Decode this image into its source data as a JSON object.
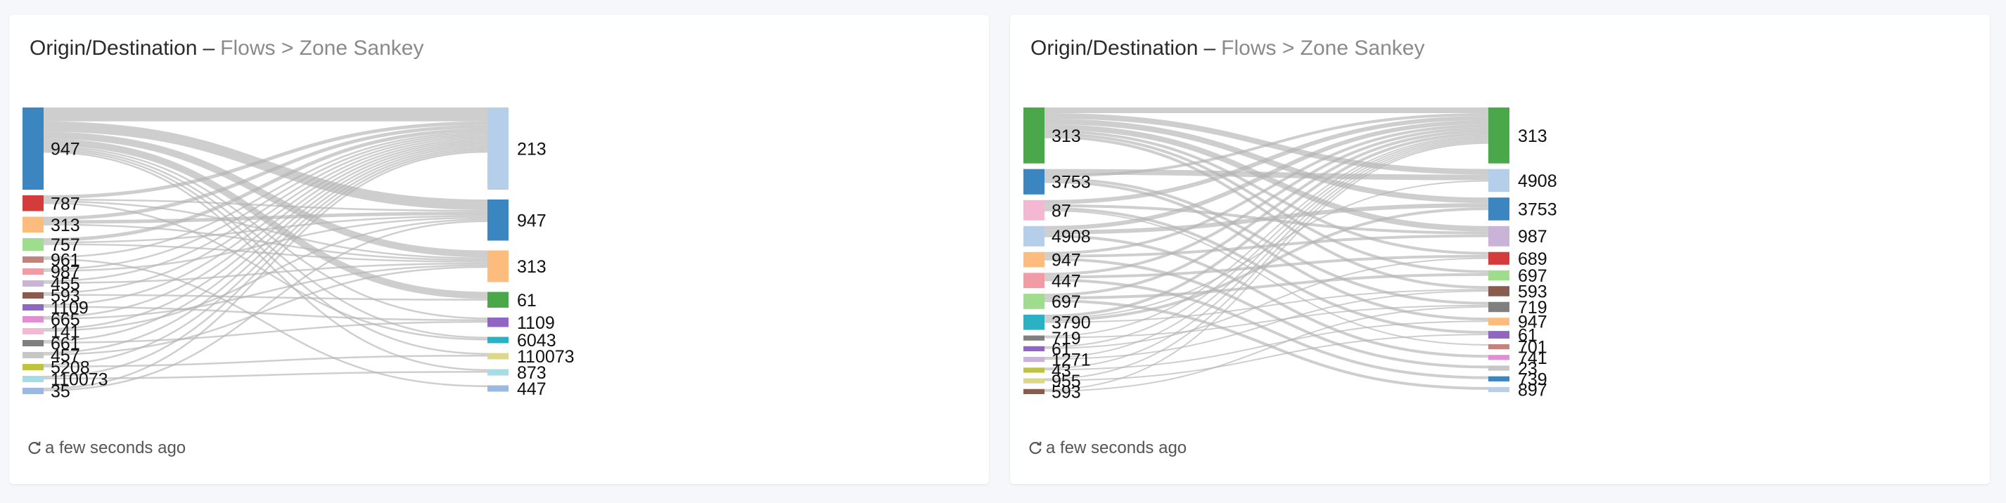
{
  "panels": [
    {
      "title": "Origin/Destination",
      "separator": "–",
      "path": "Flows > Zone Sankey",
      "updated": "a few seconds ago",
      "chart_data": {
        "type": "sankey",
        "sources": [
          {
            "label": "947",
            "color": "#3b86c0",
            "size": 26
          },
          {
            "label": "787",
            "color": "#d43c3c",
            "size": 5
          },
          {
            "label": "313",
            "color": "#fcbc7e",
            "size": 5
          },
          {
            "label": "757",
            "color": "#9fdc8e",
            "size": 4
          },
          {
            "label": "961",
            "color": "#c5827a",
            "size": 2
          },
          {
            "label": "987",
            "color": "#f19ca5",
            "size": 2
          },
          {
            "label": "455",
            "color": "#c9b4d8",
            "size": 2
          },
          {
            "label": "593",
            "color": "#8a5c50",
            "size": 2
          },
          {
            "label": "1109",
            "color": "#9166c2",
            "size": 2
          },
          {
            "label": "665",
            "color": "#e18ed2",
            "size": 2
          },
          {
            "label": "141",
            "color": "#f5b8d3",
            "size": 2
          },
          {
            "label": "661",
            "color": "#7f7f7f",
            "size": 2
          },
          {
            "label": "457",
            "color": "#c7c7c7",
            "size": 2
          },
          {
            "label": "5208",
            "color": "#bfc23e",
            "size": 2
          },
          {
            "label": "110073",
            "color": "#a6dce6",
            "size": 2
          },
          {
            "label": "35",
            "color": "#9bb8e0",
            "size": 2
          }
        ],
        "targets": [
          {
            "label": "213",
            "color": "#b5ceea",
            "size": 26
          },
          {
            "label": "947",
            "color": "#3b86c0",
            "size": 13
          },
          {
            "label": "313",
            "color": "#fcbc7e",
            "size": 10
          },
          {
            "label": "61",
            "color": "#4aa84a",
            "size": 5
          },
          {
            "label": "1109",
            "color": "#9166c2",
            "size": 3
          },
          {
            "label": "6043",
            "color": "#2bb1c4",
            "size": 2
          },
          {
            "label": "110073",
            "color": "#dbd88d",
            "size": 2
          },
          {
            "label": "873",
            "color": "#a6dce6",
            "size": 2
          },
          {
            "label": "447",
            "color": "#9bb8e0",
            "size": 2
          }
        ],
        "links": [
          [
            0,
            0,
            8
          ],
          [
            0,
            1,
            6
          ],
          [
            0,
            2,
            4
          ],
          [
            0,
            3,
            4
          ],
          [
            0,
            4,
            1
          ],
          [
            0,
            5,
            1
          ],
          [
            0,
            6,
            1
          ],
          [
            0,
            7,
            1
          ],
          [
            1,
            0,
            2
          ],
          [
            1,
            1,
            1
          ],
          [
            1,
            2,
            1
          ],
          [
            1,
            5,
            1
          ],
          [
            2,
            0,
            2
          ],
          [
            2,
            1,
            2
          ],
          [
            2,
            2,
            1
          ],
          [
            3,
            0,
            2
          ],
          [
            3,
            1,
            1
          ],
          [
            3,
            2,
            1
          ],
          [
            4,
            0,
            1
          ],
          [
            4,
            8,
            1
          ],
          [
            5,
            0,
            1
          ],
          [
            5,
            1,
            1
          ],
          [
            6,
            0,
            1
          ],
          [
            6,
            2,
            1
          ],
          [
            7,
            0,
            1
          ],
          [
            7,
            3,
            1
          ],
          [
            8,
            0,
            1
          ],
          [
            8,
            4,
            1
          ],
          [
            9,
            0,
            1
          ],
          [
            9,
            2,
            1
          ],
          [
            10,
            0,
            1
          ],
          [
            10,
            1,
            1
          ],
          [
            11,
            0,
            1
          ],
          [
            11,
            4,
            1
          ],
          [
            12,
            0,
            1
          ],
          [
            12,
            2,
            1
          ],
          [
            13,
            0,
            1
          ],
          [
            13,
            6,
            1
          ],
          [
            14,
            0,
            1
          ],
          [
            14,
            7,
            1
          ],
          [
            15,
            0,
            1
          ],
          [
            15,
            1,
            1
          ]
        ]
      }
    },
    {
      "title": "Origin/Destination",
      "separator": "–",
      "path": "Flows > Zone Sankey",
      "updated": "a few seconds ago",
      "chart_data": {
        "type": "sankey",
        "sources": [
          {
            "label": "313",
            "color": "#4aa84a",
            "size": 22
          },
          {
            "label": "3753",
            "color": "#3b86c0",
            "size": 10
          },
          {
            "label": "87",
            "color": "#f5b8d3",
            "size": 8
          },
          {
            "label": "4908",
            "color": "#b5ceea",
            "size": 8
          },
          {
            "label": "947",
            "color": "#fcbc7e",
            "size": 6
          },
          {
            "label": "447",
            "color": "#f19ca5",
            "size": 6
          },
          {
            "label": "697",
            "color": "#9fdc8e",
            "size": 6
          },
          {
            "label": "3790",
            "color": "#2bb1c4",
            "size": 6
          },
          {
            "label": "719",
            "color": "#7f7f7f",
            "size": 2
          },
          {
            "label": "61",
            "color": "#9166c2",
            "size": 2
          },
          {
            "label": "1271",
            "color": "#c9b4d8",
            "size": 2
          },
          {
            "label": "43",
            "color": "#bfc23e",
            "size": 2
          },
          {
            "label": "955",
            "color": "#dbd88d",
            "size": 2
          },
          {
            "label": "593",
            "color": "#8a5c50",
            "size": 2
          }
        ],
        "targets": [
          {
            "label": "313",
            "color": "#4aa84a",
            "size": 22
          },
          {
            "label": "4908",
            "color": "#b5ceea",
            "size": 9
          },
          {
            "label": "3753",
            "color": "#3b86c0",
            "size": 9
          },
          {
            "label": "987",
            "color": "#c9b4d8",
            "size": 8
          },
          {
            "label": "689",
            "color": "#d43c3c",
            "size": 5
          },
          {
            "label": "697",
            "color": "#9fdc8e",
            "size": 4
          },
          {
            "label": "593",
            "color": "#8a5c50",
            "size": 4
          },
          {
            "label": "719",
            "color": "#7f7f7f",
            "size": 4
          },
          {
            "label": "947",
            "color": "#fcbc7e",
            "size": 3
          },
          {
            "label": "61",
            "color": "#9166c2",
            "size": 3
          },
          {
            "label": "701",
            "color": "#c5827a",
            "size": 2
          },
          {
            "label": "741",
            "color": "#e18ed2",
            "size": 2
          },
          {
            "label": "23",
            "color": "#c7c7c7",
            "size": 2
          },
          {
            "label": "739",
            "color": "#3b86c0",
            "size": 2
          },
          {
            "label": "897",
            "color": "#b5ceea",
            "size": 2
          }
        ],
        "links": [
          [
            0,
            0,
            4
          ],
          [
            0,
            1,
            4
          ],
          [
            0,
            2,
            4
          ],
          [
            0,
            3,
            4
          ],
          [
            0,
            4,
            2
          ],
          [
            0,
            5,
            2
          ],
          [
            0,
            6,
            2
          ],
          [
            1,
            1,
            4
          ],
          [
            1,
            0,
            2
          ],
          [
            1,
            7,
            2
          ],
          [
            1,
            8,
            2
          ],
          [
            2,
            0,
            3
          ],
          [
            2,
            3,
            2
          ],
          [
            2,
            9,
            2
          ],
          [
            2,
            10,
            1
          ],
          [
            3,
            0,
            3
          ],
          [
            3,
            2,
            3
          ],
          [
            3,
            11,
            2
          ],
          [
            4,
            0,
            2
          ],
          [
            4,
            3,
            2
          ],
          [
            4,
            12,
            2
          ],
          [
            5,
            0,
            2
          ],
          [
            5,
            4,
            2
          ],
          [
            5,
            13,
            2
          ],
          [
            6,
            0,
            2
          ],
          [
            6,
            5,
            2
          ],
          [
            6,
            14,
            2
          ],
          [
            7,
            0,
            2
          ],
          [
            7,
            1,
            1
          ],
          [
            7,
            2,
            2
          ],
          [
            7,
            6,
            1
          ],
          [
            8,
            0,
            1
          ],
          [
            8,
            7,
            1
          ],
          [
            9,
            0,
            1
          ],
          [
            9,
            4,
            1
          ],
          [
            10,
            0,
            1
          ],
          [
            10,
            6,
            1
          ],
          [
            11,
            0,
            1
          ],
          [
            11,
            8,
            1
          ],
          [
            12,
            0,
            1
          ],
          [
            12,
            9,
            1
          ],
          [
            13,
            0,
            1
          ],
          [
            13,
            7,
            1
          ]
        ]
      }
    }
  ]
}
